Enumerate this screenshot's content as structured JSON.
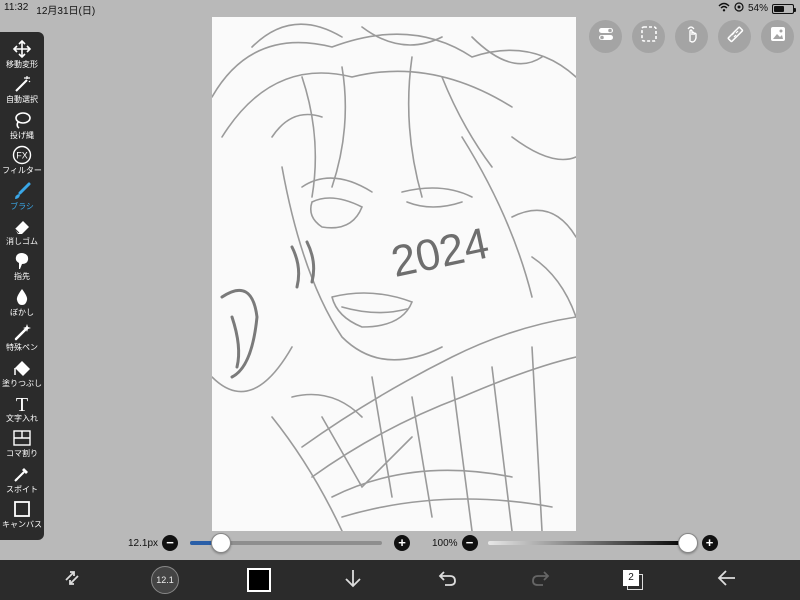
{
  "status": {
    "time": "11:32",
    "date": "12月31日(日)",
    "battery": "54%",
    "battery_level": 0.54
  },
  "tools": [
    {
      "label": "移動変形",
      "icon": "move-icon"
    },
    {
      "label": "自動選択",
      "icon": "magic-wand-icon"
    },
    {
      "label": "投げ縄",
      "icon": "lasso-icon"
    },
    {
      "label": "フィルター",
      "icon": "fx-icon",
      "icon_text": "FX"
    },
    {
      "label": "ブラシ",
      "icon": "brush-icon",
      "active": true
    },
    {
      "label": "消しゴム",
      "icon": "eraser-icon"
    },
    {
      "label": "指先",
      "icon": "finger-icon"
    },
    {
      "label": "ぼかし",
      "icon": "blur-drop-icon"
    },
    {
      "label": "特殊ペン",
      "icon": "special-pen-icon"
    },
    {
      "label": "塗りつぶし",
      "icon": "fill-bucket-icon"
    },
    {
      "label": "文字入れ",
      "icon": "text-icon",
      "icon_text": "T"
    },
    {
      "label": "コマ割り",
      "icon": "panel-split-icon"
    },
    {
      "label": "スポイト",
      "icon": "eyedropper-icon"
    },
    {
      "label": "キャンバス",
      "icon": "canvas-icon"
    }
  ],
  "brush": {
    "size_label": "12.1px",
    "size_fraction": 0.16,
    "opacity_label": "100%",
    "opacity_fraction": 1.0,
    "preview_label": "12.1"
  },
  "layers": {
    "count": "2"
  },
  "canvas": {
    "sketch_text": "2024"
  },
  "colors": {
    "primary": "#000000",
    "toolbar_bg": "#2b2b2b",
    "accent": "#3aa7e8"
  }
}
